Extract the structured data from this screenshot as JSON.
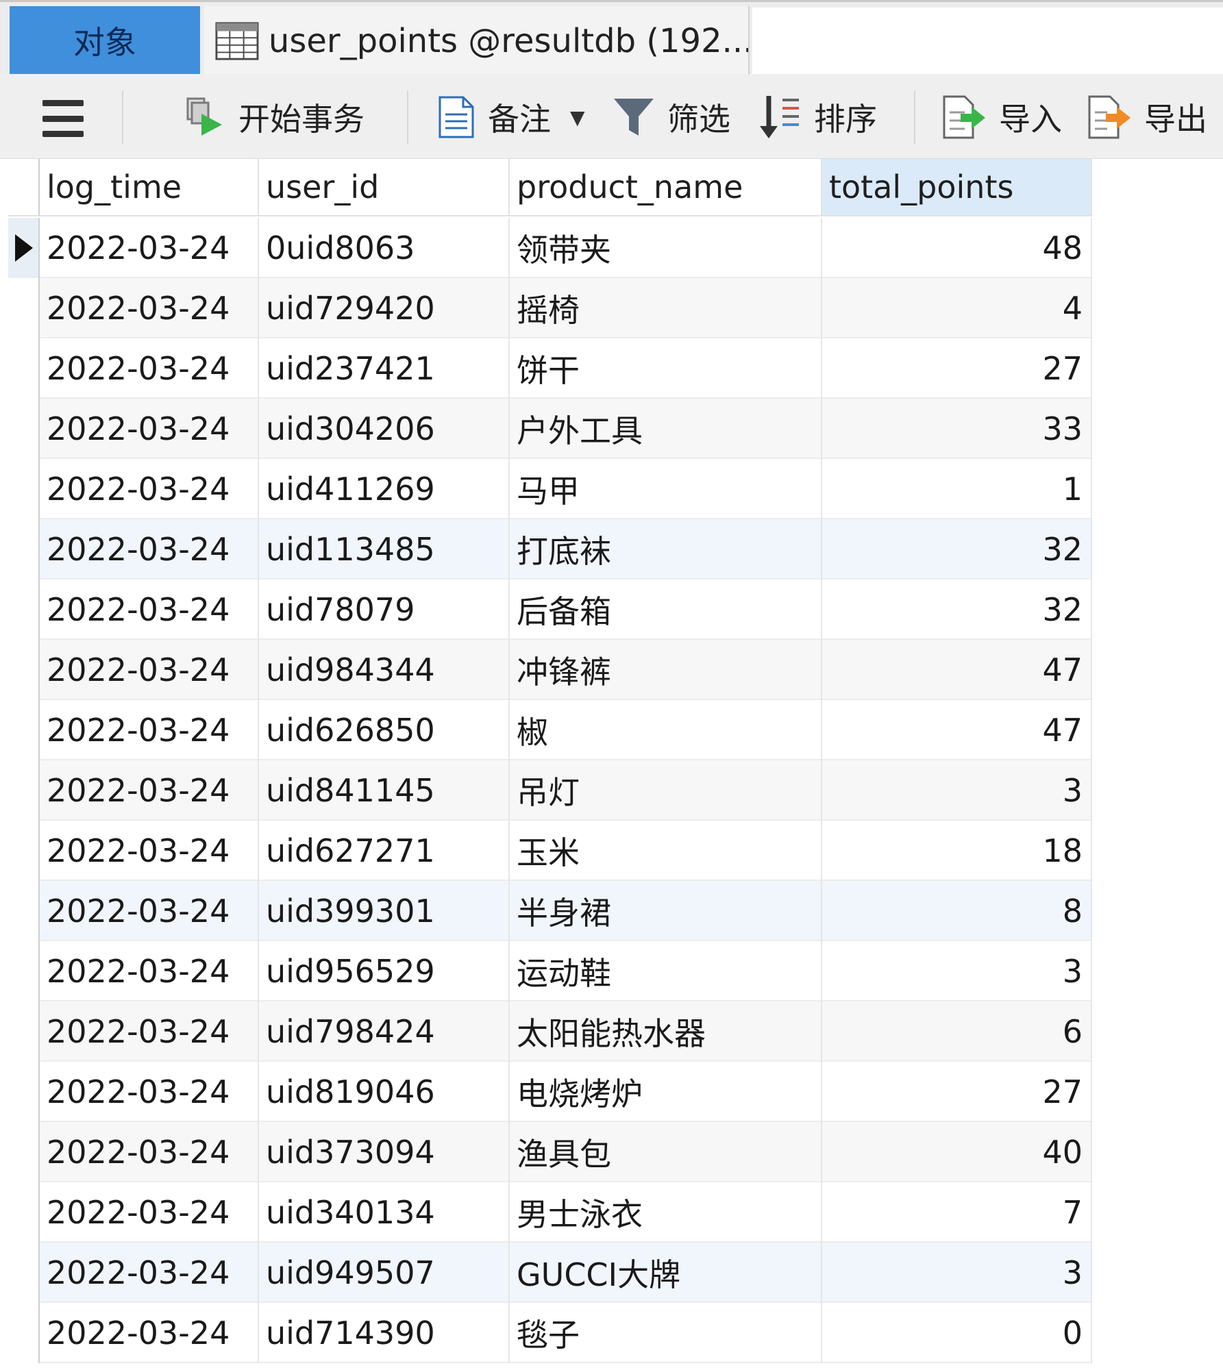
{
  "tabs": {
    "objects_label": "对象",
    "table_tab_label": "user_points @resultdb (192...."
  },
  "toolbar": {
    "begin_transaction": "开始事务",
    "notes": "备注",
    "filter": "筛选",
    "sort": "排序",
    "import": "导入",
    "export": "导出"
  },
  "columns": [
    "log_time",
    "user_id",
    "product_name",
    "total_points"
  ],
  "rows": [
    {
      "log_time": "2022-03-24",
      "user_id": "0uid8063",
      "product_name": "领带夹",
      "total_points": "48"
    },
    {
      "log_time": "2022-03-24",
      "user_id": "uid729420",
      "product_name": "摇椅",
      "total_points": "4"
    },
    {
      "log_time": "2022-03-24",
      "user_id": "uid237421",
      "product_name": "饼干",
      "total_points": "27"
    },
    {
      "log_time": "2022-03-24",
      "user_id": "uid304206",
      "product_name": "户外工具",
      "total_points": "33"
    },
    {
      "log_time": "2022-03-24",
      "user_id": "uid411269",
      "product_name": "马甲",
      "total_points": "1"
    },
    {
      "log_time": "2022-03-24",
      "user_id": "uid113485",
      "product_name": "打底袜",
      "total_points": "32"
    },
    {
      "log_time": "2022-03-24",
      "user_id": "uid78079",
      "product_name": "后备箱",
      "total_points": "32"
    },
    {
      "log_time": "2022-03-24",
      "user_id": "uid984344",
      "product_name": "冲锋裤",
      "total_points": "47"
    },
    {
      "log_time": "2022-03-24",
      "user_id": "uid626850",
      "product_name": "椒",
      "total_points": "47"
    },
    {
      "log_time": "2022-03-24",
      "user_id": "uid841145",
      "product_name": "吊灯",
      "total_points": "3"
    },
    {
      "log_time": "2022-03-24",
      "user_id": "uid627271",
      "product_name": "玉米",
      "total_points": "18"
    },
    {
      "log_time": "2022-03-24",
      "user_id": "uid399301",
      "product_name": "半身裙",
      "total_points": "8"
    },
    {
      "log_time": "2022-03-24",
      "user_id": "uid956529",
      "product_name": "运动鞋",
      "total_points": "3"
    },
    {
      "log_time": "2022-03-24",
      "user_id": "uid798424",
      "product_name": "太阳能热水器",
      "total_points": "6"
    },
    {
      "log_time": "2022-03-24",
      "user_id": "uid819046",
      "product_name": "电烧烤炉",
      "total_points": "27"
    },
    {
      "log_time": "2022-03-24",
      "user_id": "uid373094",
      "product_name": "渔具包",
      "total_points": "40"
    },
    {
      "log_time": "2022-03-24",
      "user_id": "uid340134",
      "product_name": "男士泳衣",
      "total_points": "7"
    },
    {
      "log_time": "2022-03-24",
      "user_id": "uid949507",
      "product_name": "GUCCI大牌",
      "total_points": "3"
    },
    {
      "log_time": "2022-03-24",
      "user_id": "uid714390",
      "product_name": "毯子",
      "total_points": "0"
    }
  ],
  "selected_column": "total_points",
  "current_row": 1
}
